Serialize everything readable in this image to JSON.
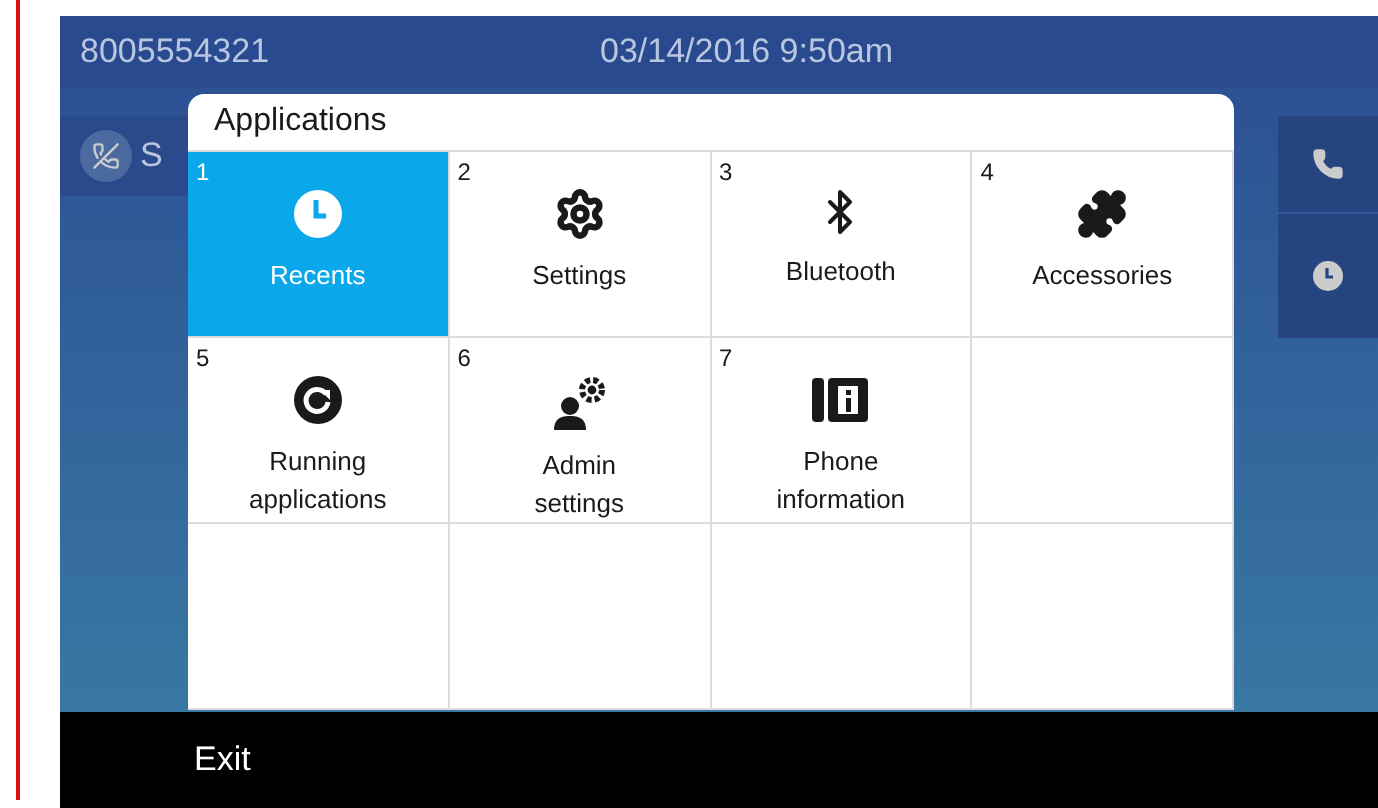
{
  "status_bar": {
    "number": "8005554321",
    "datetime": "03/14/2016 9:50am"
  },
  "call_row": {
    "text": "S"
  },
  "dialog": {
    "title": "Applications",
    "apps": [
      {
        "number": "1",
        "label": "Recents",
        "kind": "clock",
        "selected": true
      },
      {
        "number": "2",
        "label": "Settings",
        "kind": "gear",
        "selected": false
      },
      {
        "number": "3",
        "label": "Bluetooth",
        "kind": "bluetooth",
        "selected": false
      },
      {
        "number": "4",
        "label": "Accessories",
        "kind": "puzzle",
        "selected": false
      },
      {
        "number": "5",
        "label": "Running applications",
        "kind": "running",
        "selected": false
      },
      {
        "number": "6",
        "label": "Admin settings",
        "kind": "admin",
        "selected": false
      },
      {
        "number": "7",
        "label": "Phone information",
        "kind": "phoneinfo",
        "selected": false
      }
    ]
  },
  "softkeys": [
    "Exit"
  ]
}
